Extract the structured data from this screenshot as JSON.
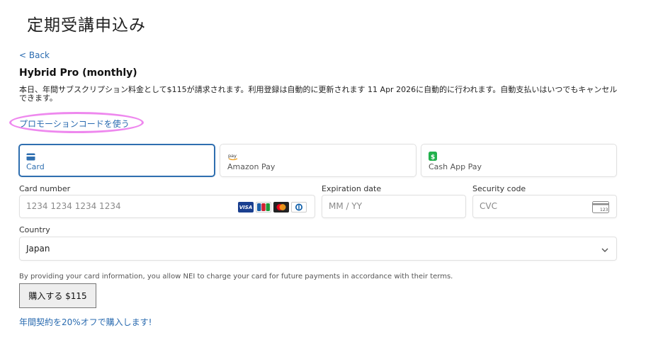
{
  "page": {
    "title": "定期受講申込み"
  },
  "nav": {
    "back_label": "< Back"
  },
  "plan": {
    "name": "Hybrid Pro (monthly)",
    "description": "本日、年間サブスクリプション料金として$115が請求されます。利用登録は自動的に更新されます 11 Apr 2026に自動的に行われます。自動支払いはいつでもキャンセルできます。"
  },
  "promo": {
    "label": "プロモーションコードを使う"
  },
  "payment_methods": [
    {
      "label": "Card",
      "icon": "card-icon",
      "selected": true
    },
    {
      "label": "Amazon Pay",
      "icon": "amazon-pay-icon",
      "selected": false
    },
    {
      "label": "Cash App Pay",
      "icon": "cash-app-icon",
      "selected": false
    }
  ],
  "form": {
    "card_number": {
      "label": "Card number",
      "placeholder": "1234 1234 1234 1234",
      "value": ""
    },
    "card_brands": [
      "VISA",
      "JCB",
      "Mastercard",
      "Diners"
    ],
    "expiration": {
      "label": "Expiration date",
      "placeholder": "MM / YY",
      "value": ""
    },
    "security_code": {
      "label": "Security code",
      "placeholder": "CVC",
      "value": "",
      "icon_text": "123"
    },
    "country": {
      "label": "Country",
      "value": "Japan"
    }
  },
  "consent_text": "By providing your card information, you allow NEI to charge your card for future payments in accordance with their terms.",
  "actions": {
    "buy_label": "購入する $115",
    "annual_label": "年間契約を20%オフで購入します!"
  },
  "colors": {
    "link": "#2a6bb0",
    "selected_tab": "#2f6fb0",
    "promo_highlight": "#ee88ee",
    "cash_app_green": "#22b14c"
  }
}
